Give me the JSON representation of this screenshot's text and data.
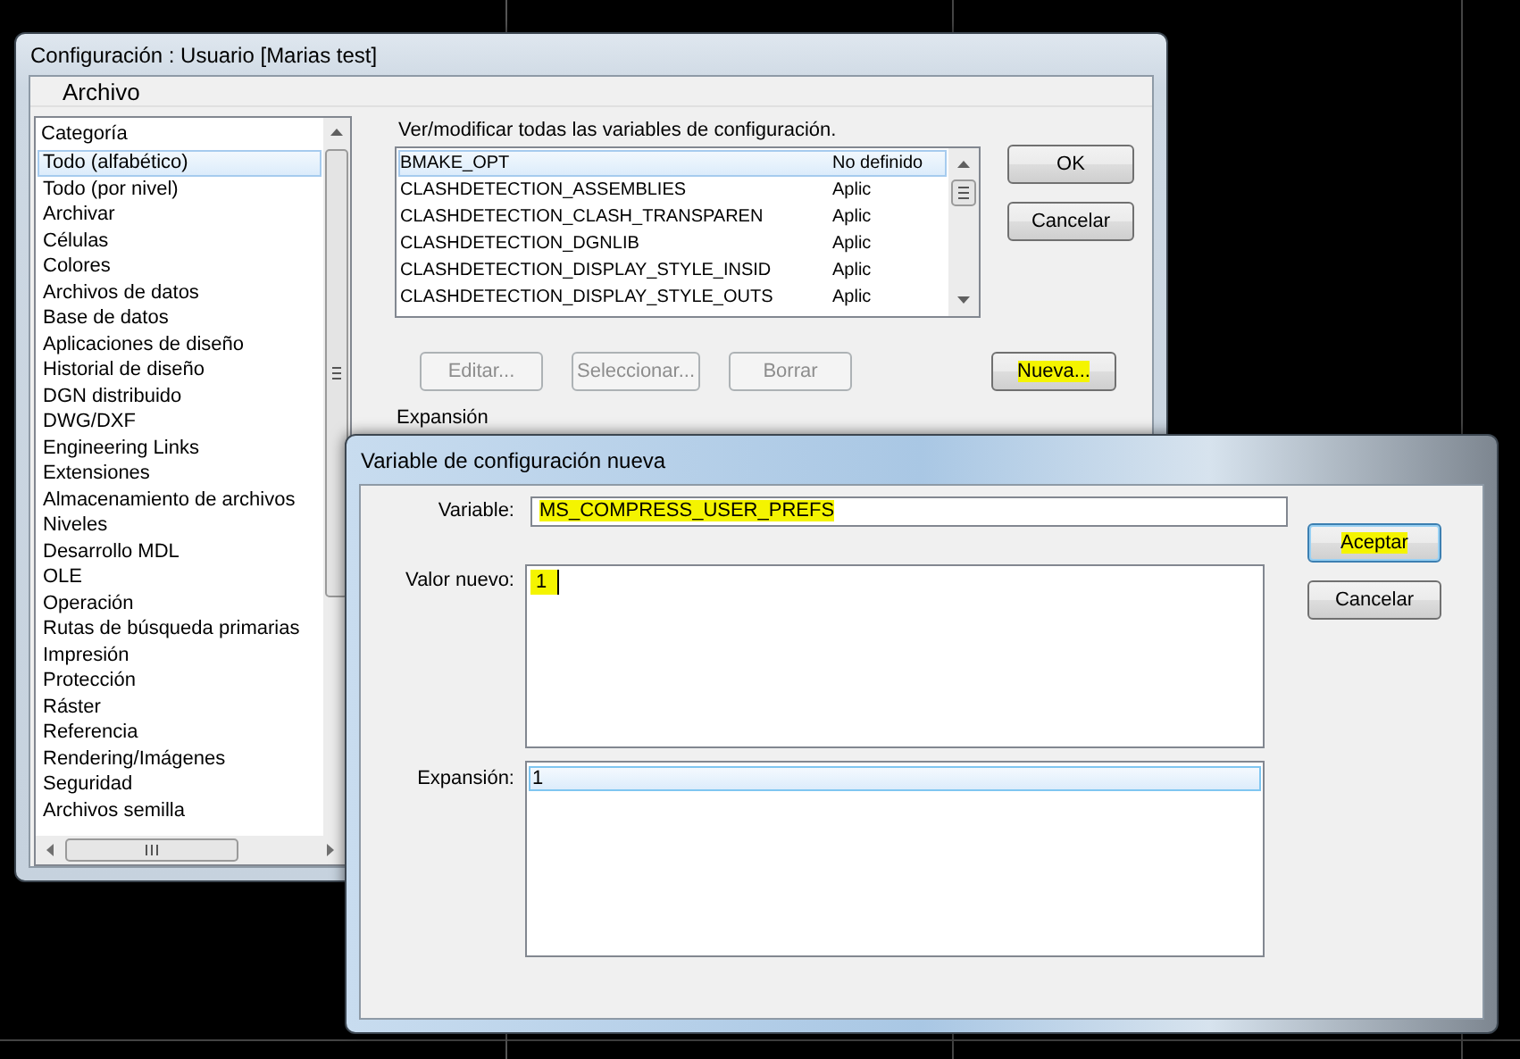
{
  "main_window": {
    "title": "Configuración : Usuario [Marias test]",
    "menu": [
      "Archivo"
    ],
    "category_header": "Categoría",
    "categories": [
      {
        "label": "Todo (alfabético)",
        "selected": true
      },
      {
        "label": "Todo (por nivel)",
        "selected": false
      },
      {
        "label": "Archivar",
        "selected": false
      },
      {
        "label": "Células",
        "selected": false
      },
      {
        "label": "Colores",
        "selected": false
      },
      {
        "label": "Archivos de datos",
        "selected": false
      },
      {
        "label": "Base de datos",
        "selected": false
      },
      {
        "label": "Aplicaciones de diseño",
        "selected": false
      },
      {
        "label": "Historial de diseño",
        "selected": false
      },
      {
        "label": "DGN distribuido",
        "selected": false
      },
      {
        "label": "DWG/DXF",
        "selected": false
      },
      {
        "label": "Engineering Links",
        "selected": false
      },
      {
        "label": "Extensiones",
        "selected": false
      },
      {
        "label": "Almacenamiento de archivos",
        "selected": false
      },
      {
        "label": "Niveles",
        "selected": false
      },
      {
        "label": "Desarrollo MDL",
        "selected": false
      },
      {
        "label": "OLE",
        "selected": false
      },
      {
        "label": "Operación",
        "selected": false
      },
      {
        "label": "Rutas de búsqueda primarias",
        "selected": false
      },
      {
        "label": "Impresión",
        "selected": false
      },
      {
        "label": "Protección",
        "selected": false
      },
      {
        "label": "Ráster",
        "selected": false
      },
      {
        "label": "Referencia",
        "selected": false
      },
      {
        "label": "Rendering/Imágenes",
        "selected": false
      },
      {
        "label": "Seguridad",
        "selected": false
      },
      {
        "label": "Archivos semilla",
        "selected": false
      }
    ],
    "variables_label": "Ver/modificar todas las variables de configuración.",
    "variables": [
      {
        "name": "BMAKE_OPT",
        "scope": "No definido",
        "selected": true
      },
      {
        "name": "CLASHDETECTION_ASSEMBLIES",
        "scope": "Aplic",
        "selected": false
      },
      {
        "name": "CLASHDETECTION_CLASH_TRANSPAREN",
        "scope": "Aplic",
        "selected": false
      },
      {
        "name": "CLASHDETECTION_DGNLIB",
        "scope": "Aplic",
        "selected": false
      },
      {
        "name": "CLASHDETECTION_DISPLAY_STYLE_INSID",
        "scope": "Aplic",
        "selected": false
      },
      {
        "name": "CLASHDETECTION_DISPLAY_STYLE_OUTS",
        "scope": "Aplic",
        "selected": false
      }
    ],
    "side_buttons": [
      {
        "label": "OK"
      },
      {
        "label": "Cancelar"
      }
    ],
    "action_buttons": [
      {
        "label": "Editar...",
        "disabled": true,
        "highlighted": false
      },
      {
        "label": "Seleccionar...",
        "disabled": true,
        "highlighted": false
      },
      {
        "label": "Borrar",
        "disabled": true,
        "highlighted": false
      },
      {
        "label": "Nueva...",
        "disabled": false,
        "highlighted": true
      }
    ],
    "expansion_label": "Expansión"
  },
  "new_variable_dialog": {
    "title": "Variable de configuración nueva",
    "variable_label": "Variable:",
    "variable_value": "MS_COMPRESS_USER_PREFS",
    "variable_highlighted": true,
    "new_value_label": "Valor nuevo:",
    "new_value": "1",
    "new_value_highlighted": true,
    "expansion_label": "Expansión:",
    "expansion_rows": [
      {
        "text": "1",
        "selected": true
      }
    ],
    "buttons": [
      {
        "label": "Aceptar",
        "default": true,
        "highlighted": true
      },
      {
        "label": "Cancelar",
        "default": false,
        "highlighted": false
      }
    ]
  }
}
